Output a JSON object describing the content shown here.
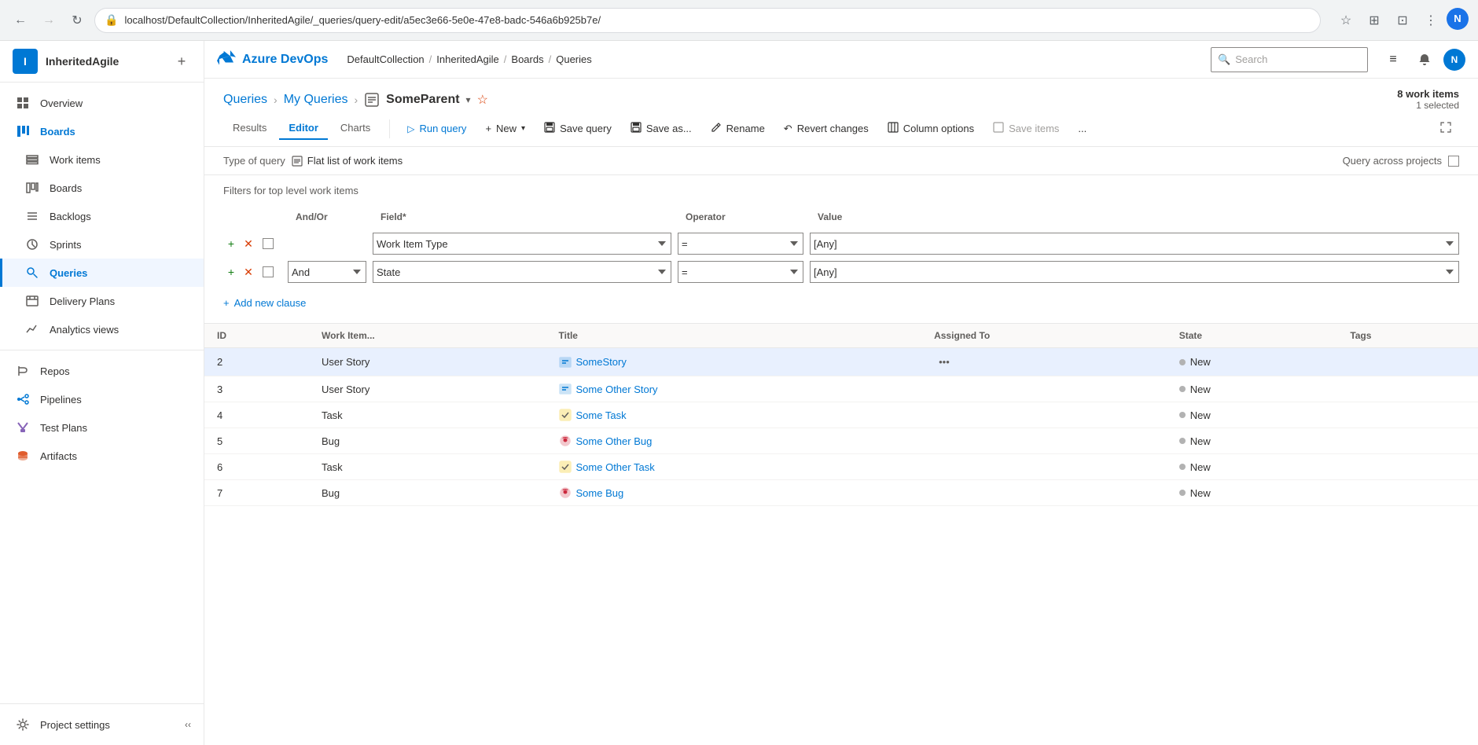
{
  "browser": {
    "url": "localhost/DefaultCollection/InheritedAgile/_queries/query-edit/a5ec3e66-5e0e-47e8-badc-546a6b925b7e/",
    "back_disabled": false,
    "forward_disabled": true
  },
  "topnav": {
    "azure_devops": "Azure DevOps",
    "breadcrumb": [
      "DefaultCollection",
      "InheritedAgile",
      "Boards",
      "Queries"
    ],
    "search_placeholder": "Search",
    "profile_initial": "N"
  },
  "sidebar": {
    "org_name": "InheritedAgile",
    "org_initial": "I",
    "items": [
      {
        "id": "overview",
        "label": "Overview",
        "icon": "overview"
      },
      {
        "id": "boards",
        "label": "Boards",
        "icon": "boards",
        "section_header": true
      },
      {
        "id": "work-items",
        "label": "Work items",
        "icon": "work-items"
      },
      {
        "id": "boards-sub",
        "label": "Boards",
        "icon": "boards-sub"
      },
      {
        "id": "backlogs",
        "label": "Backlogs",
        "icon": "backlogs"
      },
      {
        "id": "sprints",
        "label": "Sprints",
        "icon": "sprints"
      },
      {
        "id": "queries",
        "label": "Queries",
        "icon": "queries",
        "active": true
      },
      {
        "id": "delivery-plans",
        "label": "Delivery Plans",
        "icon": "delivery-plans"
      },
      {
        "id": "analytics-views",
        "label": "Analytics views",
        "icon": "analytics-views"
      },
      {
        "id": "repos",
        "label": "Repos",
        "icon": "repos"
      },
      {
        "id": "pipelines",
        "label": "Pipelines",
        "icon": "pipelines"
      },
      {
        "id": "test-plans",
        "label": "Test Plans",
        "icon": "test-plans"
      },
      {
        "id": "artifacts",
        "label": "Artifacts",
        "icon": "artifacts"
      }
    ],
    "footer": [
      {
        "id": "project-settings",
        "label": "Project settings",
        "icon": "settings"
      }
    ]
  },
  "page": {
    "breadcrumb": [
      "Queries",
      "My Queries",
      "SomeParent"
    ],
    "title": "SomeParent",
    "work_items_count": "8 work items",
    "work_items_selected": "1 selected"
  },
  "toolbar": {
    "tabs": [
      "Results",
      "Editor",
      "Charts"
    ],
    "active_tab": "Editor",
    "run_query_label": "Run query",
    "new_label": "New",
    "save_query_label": "Save query",
    "save_as_label": "Save as...",
    "rename_label": "Rename",
    "revert_label": "Revert changes",
    "column_options_label": "Column options",
    "save_items_label": "Save items",
    "more_label": "..."
  },
  "query_editor": {
    "type_label": "Type of query",
    "type_value": "Flat list of work items",
    "query_across_label": "Query across projects",
    "filters_label": "Filters for top level work items",
    "headers": {
      "andor": "And/Or",
      "field": "Field*",
      "operator": "Operator",
      "value": "Value"
    },
    "rows": [
      {
        "andor": "",
        "field": "Work Item Type",
        "operator": "=",
        "value": "[Any]"
      },
      {
        "andor": "And",
        "field": "State",
        "operator": "=",
        "value": "[Any]"
      }
    ],
    "add_clause_label": "Add new clause"
  },
  "results": {
    "columns": [
      "ID",
      "Work Item...",
      "Title",
      "Assigned To",
      "State",
      "Tags"
    ],
    "rows": [
      {
        "id": 2,
        "type": "User Story",
        "type_icon": "user-story",
        "title": "SomeStory",
        "assigned_to": "",
        "state": "New",
        "tags": "",
        "selected": true,
        "has_actions": true
      },
      {
        "id": 3,
        "type": "User Story",
        "type_icon": "user-story",
        "title": "Some Other Story",
        "assigned_to": "",
        "state": "New",
        "tags": ""
      },
      {
        "id": 4,
        "type": "Task",
        "type_icon": "task",
        "title": "Some Task",
        "assigned_to": "",
        "state": "New",
        "tags": ""
      },
      {
        "id": 5,
        "type": "Bug",
        "type_icon": "bug",
        "title": "Some Other Bug",
        "assigned_to": "",
        "state": "New",
        "tags": ""
      },
      {
        "id": 6,
        "type": "Task",
        "type_icon": "task",
        "title": "Some Other Task",
        "assigned_to": "",
        "state": "New",
        "tags": ""
      },
      {
        "id": 7,
        "type": "Bug",
        "type_icon": "bug",
        "title": "Some Bug",
        "assigned_to": "",
        "state": "New",
        "tags": ""
      }
    ]
  },
  "icons": {
    "overview": "⬡",
    "user_story": "▊",
    "task": "✔",
    "bug": "🐞"
  }
}
